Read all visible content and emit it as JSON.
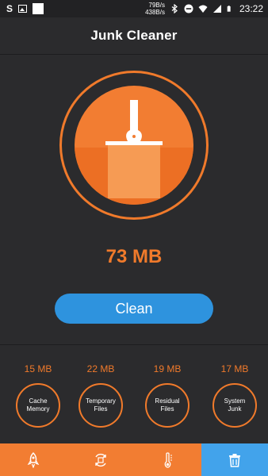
{
  "status_bar": {
    "net_up": "79B/s",
    "net_down": "438B/s",
    "time": "23:22",
    "icons": [
      "s-notification-icon",
      "image-icon",
      "white-square-icon",
      "bluetooth-icon",
      "dnd-icon",
      "wifi-icon",
      "signal-icon",
      "battery-icon"
    ]
  },
  "header": {
    "title": "Junk Cleaner"
  },
  "main": {
    "junk_size": "73 MB",
    "clean_label": "Clean",
    "icon": "broom-icon"
  },
  "categories": [
    {
      "size": "15 MB",
      "label_line1": "Cache",
      "label_line2": "Memory"
    },
    {
      "size": "22 MB",
      "label_line1": "Temporary",
      "label_line2": "Files"
    },
    {
      "size": "19 MB",
      "label_line1": "Residual",
      "label_line2": "Files"
    },
    {
      "size": "17 MB",
      "label_line1": "System",
      "label_line2": "Junk"
    }
  ],
  "bottom_nav": {
    "tabs": [
      {
        "icon": "rocket-icon",
        "active": false
      },
      {
        "icon": "cpu-cycle-icon",
        "active": false
      },
      {
        "icon": "thermometer-icon",
        "active": false
      },
      {
        "icon": "trash-icon",
        "active": true
      }
    ]
  },
  "colors": {
    "accent_orange": "#f07a2b",
    "accent_blue": "#2e93de",
    "nav_active_blue": "#42a3eb",
    "background": "#2b2b2d"
  }
}
